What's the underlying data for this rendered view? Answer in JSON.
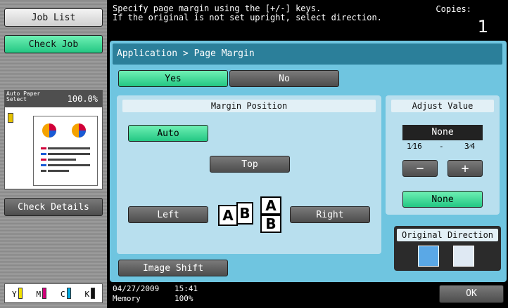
{
  "sidebar": {
    "job_list": "Job List",
    "check_job": "Check Job",
    "preview_paper": "Auto Paper\nSelect",
    "preview_zoom": "100.0%",
    "check_details": "Check Details",
    "toner": [
      {
        "label": "Y",
        "color": "#f2e100"
      },
      {
        "label": "M",
        "color": "#d1007a"
      },
      {
        "label": "C",
        "color": "#00a9e0"
      },
      {
        "label": "K",
        "color": "#111111"
      }
    ]
  },
  "message": {
    "line1": "Specify page margin using the [+/-] keys.",
    "line2": "If the original is not set upright, select direction.",
    "copies_label": "Copies:",
    "copies_value": "1"
  },
  "main": {
    "breadcrumb": "Application > Page Margin",
    "yes": "Yes",
    "no": "No",
    "margin_position": {
      "title": "Margin Position",
      "auto": "Auto",
      "top": "Top",
      "left": "Left",
      "right": "Right"
    },
    "adjust_value": {
      "title": "Adjust Value",
      "display": "None",
      "min": "1⁄16",
      "dash": "-",
      "max": "3⁄4",
      "minus": "−",
      "plus": "+",
      "none": "None"
    },
    "original_direction": {
      "title": "Original Direction"
    },
    "image_shift": "Image Shift"
  },
  "footer": {
    "date": "04/27/2009",
    "time": "15:41",
    "memory_label": "Memory",
    "memory_value": "100%",
    "ok": "OK"
  }
}
